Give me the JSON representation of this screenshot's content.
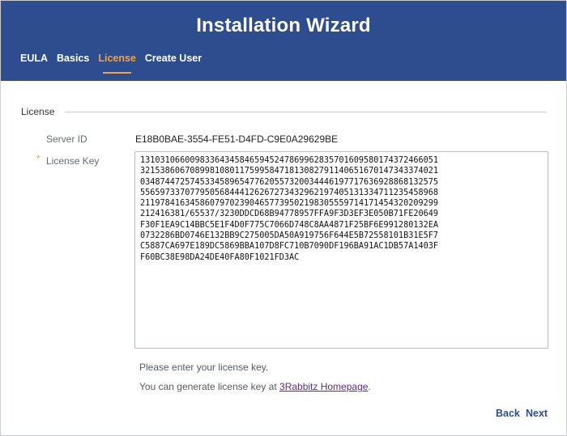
{
  "header": {
    "title": "Installation Wizard",
    "tabs": [
      {
        "label": "EULA"
      },
      {
        "label": "Basics"
      },
      {
        "label": "License",
        "active": true
      },
      {
        "label": "Create User"
      }
    ],
    "background_color": "#2d4d8f",
    "active_tab_color": "#f2a33a"
  },
  "section": {
    "title": "License"
  },
  "form": {
    "server_id_label": "Server ID",
    "server_id_value": "E18B0BAE-3554-FE51-D4FD-C9E0A29629BE",
    "license_key_label": "License Key",
    "required_marker": "*",
    "license_key_value": "1310310660098336434584659452478699628357016095801743724660513215386067089981080117599584718130827911406516701473433740210348744725745334589654776205573200344461977176369288681325755565973370779505684441262672734329621974051313347112354589682119784163458607970239046577395021983055597141714543202092992124163 81/65537/3230DDCD68B94778957FFA9F3D3EF3E050B71FE20649F30F1EA9C14BBC5E1F4D0F775C7066D748C8AA4871F25BF6E991280132EA0732286BD0746E132BB9C275005DA50A919756F644E5B72558101B31E5F7C5887CA697E189DC5869BBA107D8FC710B7090DF196BA91AC1DB57A1403FF60BC38E98DA24DE40FA80F1021FD3AC",
    "license_key_lines": [
      "131031066009833643458465945247869962835701609580174372466051",
      "321538606708998108011759958471813082791140651670147343374021",
      "034874472574533458965477620557320034446197717636928868132575",
      "556597337077950568444126267273432962197405131334711235458968",
      "211978416345860797023904657739502198305559714171454320209299",
      "212416381/65537/3230DDCD68B94778957FFA9F3D3EF3E050B71FE20649",
      "F30F1EA9C14BBC5E1F4D0F775C7066D748C8AA4871F25BF6E991280132EA",
      "0732286BD0746E132BB9C275005DA50A919756F644E5B72558101B31E5F7",
      "C5887CA697E189DC5869BBA107D8FC710B7090DF196BA91AC1DB57A1403F",
      "F60BC38E98DA24DE40FA80F1021FD3AC"
    ],
    "hint_text": "Please enter your license key.",
    "generate_text_prefix": "You can generate license key at ",
    "generate_link_label": "3Rabbitz Homepage",
    "generate_text_suffix": "."
  },
  "footer": {
    "back_label": "Back",
    "next_label": "Next"
  }
}
